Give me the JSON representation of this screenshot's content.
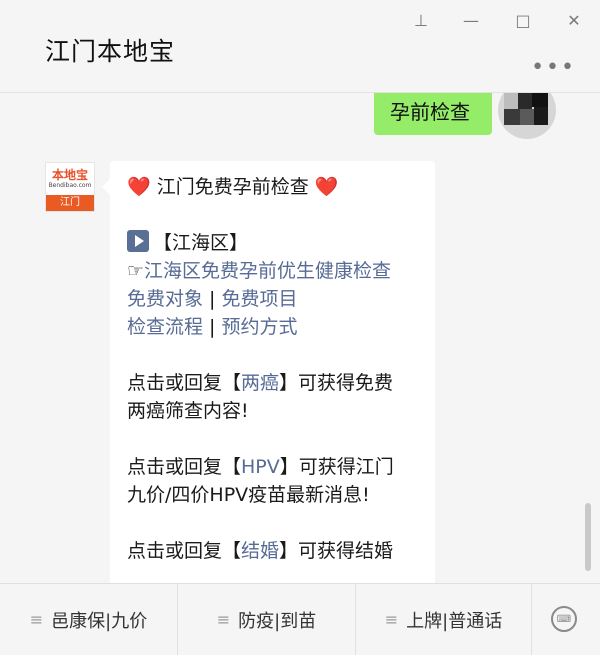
{
  "window": {
    "title": "江门本地宝",
    "more_icon": "•••",
    "controls": {
      "pin": "⊥",
      "minimize": "—",
      "maximize": "□",
      "close": "✕"
    }
  },
  "chat": {
    "self_message": "孕前检查",
    "bot_avatar": {
      "logo_main": "本地宝",
      "logo_sub": "Bendibao.com",
      "logo_city": "江门"
    },
    "bubble": {
      "heart": "❤️",
      "heading": "江门免费孕前检查",
      "district": "【江海区】",
      "pointer": "☞",
      "link_main": "江海区免费孕前优生健康检查",
      "link_target": "免费对象",
      "link_items": "免费项目",
      "link_process": "检查流程",
      "link_booking": "预约方式",
      "sep": " | ",
      "p1_before": "点击或回复【",
      "p1_keyword": "两癌",
      "p1_after_line1": "】可获得免费",
      "p1_line2": "两癌筛查内容!",
      "p2_before": "点击或回复【",
      "p2_keyword": "HPV",
      "p2_after_line1": "】可获得江门",
      "p2_line2": "九价/四价HPV疫苗最新消息!",
      "p3_before": "点击或回复【",
      "p3_keyword": "结婚",
      "p3_after_line1": "】可获得结婚"
    }
  },
  "bottom_menu": {
    "items": [
      {
        "label": "邑康保|九价"
      },
      {
        "label": "防疫|到苗"
      },
      {
        "label": "上牌|普通话"
      }
    ],
    "hamburger": "≡",
    "keyboard_icon": "⌨"
  },
  "colors": {
    "self_bubble": "#95ec69",
    "link": "#576b95",
    "brand_orange": "#ea5a23"
  }
}
